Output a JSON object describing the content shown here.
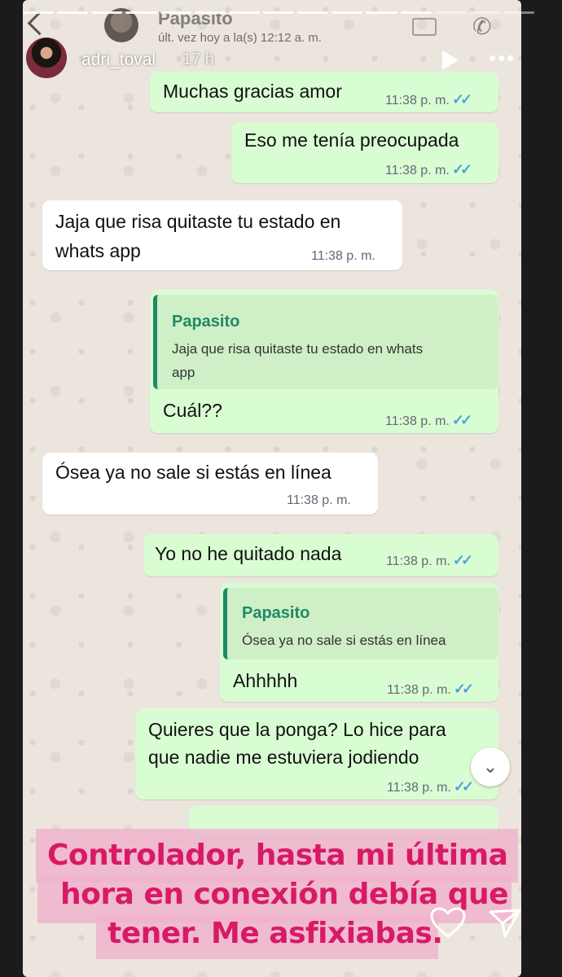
{
  "whatsapp": {
    "contact_name": "Papasito",
    "last_seen": "últ. vez hoy a la(s) 12:12 a. m."
  },
  "story": {
    "username": "adri_toval",
    "time_ago": "17 h"
  },
  "messages": [
    {
      "dir": "out",
      "text": "Muchas gracias amor",
      "time": "11:38 p. m.",
      "ticks": "✓✓"
    },
    {
      "dir": "out",
      "text": "Eso me tenía preocupada",
      "time": "11:38 p. m.",
      "ticks": "✓✓"
    },
    {
      "dir": "in",
      "lines": [
        "Jaja que risa quitaste tu estado en",
        "whats app"
      ],
      "time": "11:38 p. m."
    },
    {
      "dir": "out",
      "quote_name": "Papasito",
      "quote_lines": [
        "Jaja que risa quitaste tu estado en whats",
        "app"
      ],
      "text": "Cuál??",
      "time": "11:38 p. m.",
      "ticks": "✓✓"
    },
    {
      "dir": "in",
      "text": "Ósea ya no sale si estás en línea",
      "time": "11:38 p. m."
    },
    {
      "dir": "out",
      "text": "Yo no he quitado nada",
      "time": "11:38 p. m.",
      "ticks": "✓✓"
    },
    {
      "dir": "out",
      "quote_name": "Papasito",
      "quote_lines": [
        "Ósea ya no sale si estás en línea"
      ],
      "text": "Ahhhhh",
      "time": "11:38 p. m.",
      "ticks": "✓✓"
    },
    {
      "dir": "out",
      "lines": [
        "Quieres que la ponga? Lo hice para",
        "que nadie me estuviera jodiendo"
      ],
      "time": "11:38 p. m.",
      "ticks": "✓✓"
    }
  ],
  "caption": {
    "lines": [
      "Controlador, hasta mi última",
      "hora en conexión debía que",
      "tener. Me asfixiabas."
    ],
    "text_color": "#d81a66",
    "highlight_color": "#f0b4cd"
  },
  "icons": {
    "back": "chevron-left-icon",
    "video": "video-call-icon",
    "call": "phone-icon",
    "play": "play-icon",
    "more": "more-icon",
    "scroll": "chevron-down-icon",
    "like": "heart-icon",
    "share": "send-icon"
  },
  "colors": {
    "outgoing_bubble": "#d9fdd3",
    "incoming_bubble": "#ffffff",
    "read_ticks": "#4fa3d8",
    "quote_accent": "#1f8a66"
  }
}
